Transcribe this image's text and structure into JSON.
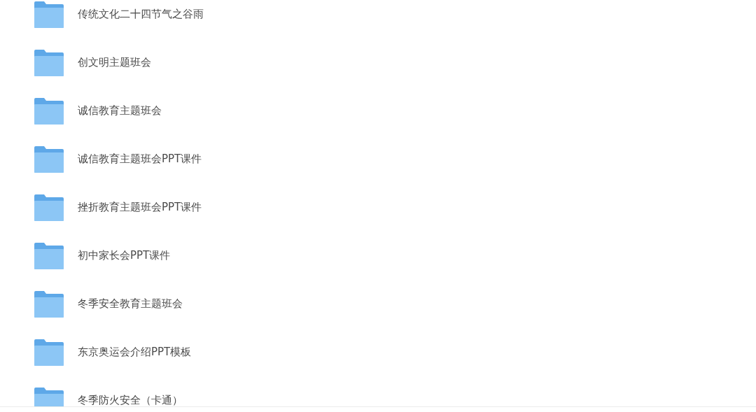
{
  "folders": [
    {
      "name": "传统文化二十四节气之谷雨"
    },
    {
      "name": "创文明主题班会"
    },
    {
      "name": "诚信教育主题班会"
    },
    {
      "name": "诚信教育主题班会PPT课件"
    },
    {
      "name": "挫折教育主题班会PPT课件"
    },
    {
      "name": "初中家长会PPT课件"
    },
    {
      "name": "冬季安全教育主题班会"
    },
    {
      "name": "东京奥运会介绍PPT模板"
    },
    {
      "name": "冬季防火安全（卡通）"
    }
  ]
}
